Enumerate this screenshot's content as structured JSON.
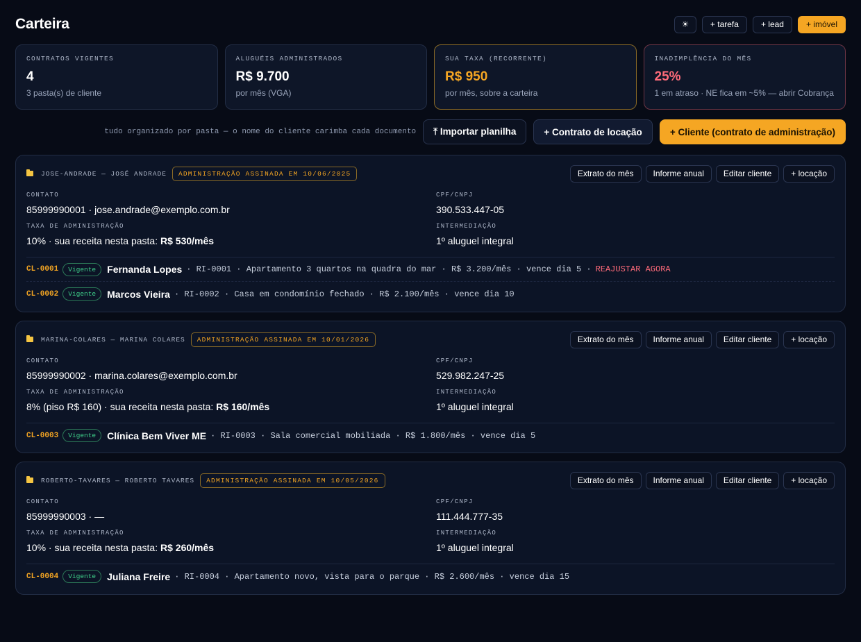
{
  "header": {
    "title": "Carteira",
    "theme_icon": "sun-icon",
    "theme_glyph": "☀",
    "buttons": [
      "+ tarefa",
      "+ lead",
      "+ imóvel"
    ]
  },
  "kpis": [
    {
      "label": "CONTRATOS VIGENTES",
      "value": "4",
      "sub": "3 pasta(s) de cliente"
    },
    {
      "label": "ALUGUÉIS ADMINISTRADOS",
      "value": "R$ 9.700",
      "sub": "por mês (VGA)"
    },
    {
      "label": "SUA TAXA (RECORRENTE)",
      "value": "R$ 950",
      "sub": "por mês, sobre a carteira"
    },
    {
      "label": "INADIMPLÊNCIA DO MÊS",
      "value": "25%",
      "sub": "1 em atraso · NE fica em ~5% — abrir Cobrança"
    }
  ],
  "actions": {
    "hint": "tudo organizado por pasta — o nome do cliente carimba cada documento",
    "import": "⤒ Importar planilha",
    "new_lease": "+ Contrato de locação",
    "new_client": "+ Cliente (contrato de administração)"
  },
  "folder_buttons": [
    "Extrato do mês",
    "Informe anual",
    "Editar cliente",
    "+ locação"
  ],
  "field_labels": {
    "contact": "CONTATO",
    "doc": "CPF/CNPJ",
    "fee": "TAXA DE ADMINISTRAÇÃO",
    "intermediation": "INTERMEDIAÇÃO"
  },
  "folders": [
    {
      "slug": "JOSE-ANDRADE — JOSÉ ANDRADE",
      "badge": "ADMINISTRAÇÃO ASSINADA EM 10/06/2025",
      "contact": "85999990001 · jose.andrade@exemplo.com.br",
      "doc": "390.533.447-05",
      "fee_prefix": "10% · sua receita nesta pasta:",
      "fee_amount": "R$ 530/mês",
      "intermediation": "1º aluguel integral",
      "contracts": [
        {
          "code": "CL-0001",
          "status": "Vigente",
          "tenant": "Fernanda Lopes",
          "details": "· RI-0001 · Apartamento 3 quartos na quadra do mar · R$ 3.200/mês · vence dia 5 ·",
          "alert": "REAJUSTAR AGORA"
        },
        {
          "code": "CL-0002",
          "status": "Vigente",
          "tenant": "Marcos Vieira",
          "details": "· RI-0002 · Casa em condomínio fechado · R$ 2.100/mês · vence dia 10",
          "alert": ""
        }
      ]
    },
    {
      "slug": "MARINA-COLARES — MARINA COLARES",
      "badge": "ADMINISTRAÇÃO ASSINADA EM 10/01/2026",
      "contact": "85999990002 · marina.colares@exemplo.com.br",
      "doc": "529.982.247-25",
      "fee_prefix": "8% (piso R$ 160) · sua receita nesta pasta:",
      "fee_amount": "R$ 160/mês",
      "intermediation": "1º aluguel integral",
      "contracts": [
        {
          "code": "CL-0003",
          "status": "Vigente",
          "tenant": "Clínica Bem Viver ME",
          "details": "· RI-0003 · Sala comercial mobiliada · R$ 1.800/mês · vence dia 5",
          "alert": ""
        }
      ]
    },
    {
      "slug": "ROBERTO-TAVARES — ROBERTO TAVARES",
      "badge": "ADMINISTRAÇÃO ASSINADA EM 10/05/2026",
      "contact": "85999990003 · —",
      "doc": "111.444.777-35",
      "fee_prefix": "10% · sua receita nesta pasta:",
      "fee_amount": "R$ 260/mês",
      "intermediation": "1º aluguel integral",
      "contracts": [
        {
          "code": "CL-0004",
          "status": "Vigente",
          "tenant": "Juliana Freire",
          "details": "· RI-0004 · Apartamento novo, vista para o parque · R$ 2.600/mês · vence dia 15",
          "alert": ""
        }
      ]
    }
  ]
}
